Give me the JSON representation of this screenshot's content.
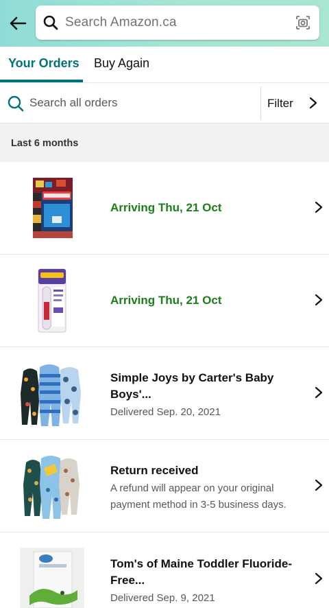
{
  "header": {
    "search_placeholder": "Search Amazon.ca"
  },
  "tabs": [
    {
      "label": "Your Orders",
      "active": true
    },
    {
      "label": "Buy Again",
      "active": false
    }
  ],
  "order_search": {
    "placeholder": "Search all orders",
    "filter_label": "Filter"
  },
  "section": {
    "label": "Last 6 months"
  },
  "orders": [
    {
      "status": "Arriving Thu, 21 Oct",
      "product_image": "scotties-tissue-box"
    },
    {
      "status": "Arriving Thu, 21 Oct",
      "product_image": "after-bite-tube"
    },
    {
      "title": "Simple Joys by Carter's Baby Boys'...",
      "detail": "Delivered Sep. 20, 2021",
      "product_image": "baby-sleepers-3-pack"
    },
    {
      "title": "Return received",
      "detail": "A refund will appear on your original payment method in 3-5 business days.",
      "product_image": "baby-sleepers-return"
    },
    {
      "title": "Tom's of Maine Toddler Fluoride-Free...",
      "detail": "Delivered Sep. 9, 2021",
      "product_image": "toms-toothpaste-box"
    }
  ],
  "colors": {
    "accent": "#00737a",
    "arrival_green": "#1b7e1b",
    "header_gradient_start": "#8fdcd6",
    "header_gradient_end": "#a8e6cf"
  }
}
